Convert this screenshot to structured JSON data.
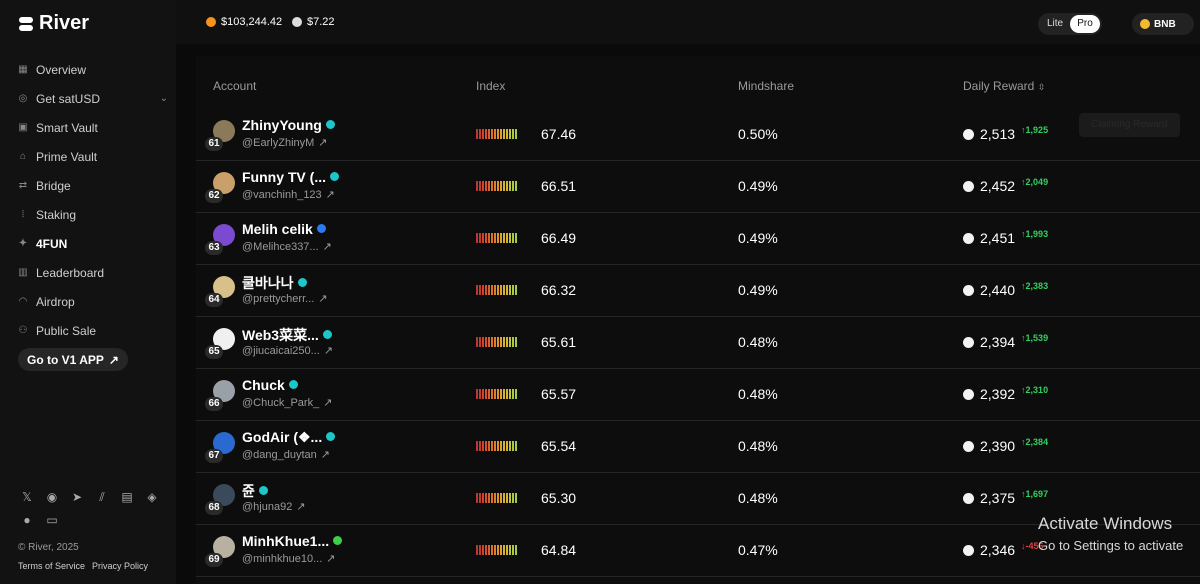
{
  "brand": {
    "name": "River"
  },
  "topbar": {
    "prices": [
      {
        "label": "$103,244.42",
        "icon": "bitcoin-icon",
        "color": "#f7931a"
      },
      {
        "label": "$7.22",
        "icon": "river-token-icon",
        "color": "#ffffff"
      }
    ],
    "mode": {
      "lite": "Lite",
      "pro": "Pro",
      "active": "Pro"
    },
    "chain": {
      "label": "BNB",
      "icon": "bnb-icon",
      "color": "#f3ba2f"
    }
  },
  "sidebar": {
    "items": [
      {
        "label": "Overview",
        "icon": "grid-icon"
      },
      {
        "label": "Get satUSD",
        "icon": "circle-dollar-icon",
        "expandable": true
      },
      {
        "label": "Smart Vault",
        "icon": "vault-icon"
      },
      {
        "label": "Prime Vault",
        "icon": "bank-icon"
      },
      {
        "label": "Bridge",
        "icon": "swap-arrows-icon"
      },
      {
        "label": "Staking",
        "icon": "chart-up-icon"
      },
      {
        "label": "4FUN",
        "icon": "fun-icon",
        "active": true
      },
      {
        "label": "Leaderboard",
        "icon": "bar-chart-icon"
      },
      {
        "label": "Airdrop",
        "icon": "parachute-icon"
      },
      {
        "label": "Public Sale",
        "icon": "users-icon"
      }
    ],
    "v1_button": "Go to V1 APP",
    "socials": [
      "x-icon",
      "discord-icon",
      "telegram-icon",
      "mirror-icon",
      "docs-icon",
      "layers-icon",
      "github-icon",
      "scroll-icon"
    ],
    "copyright": "© River, 2025",
    "terms": "Terms of Service",
    "privacy": "Privacy Policy"
  },
  "table": {
    "headers": {
      "account": "Account",
      "index": "Index",
      "mindshare": "Mindshare",
      "reward": "Daily Reward"
    },
    "ghost_button": "Claiming Reward",
    "rows": [
      {
        "rank": "61",
        "name": "ZhinyYoung",
        "handle": "@EarlyZhinyM",
        "index": "67.46",
        "mindshare": "0.50%",
        "reward": "2,513",
        "delta": "↑1,925",
        "dir": "up",
        "avatar": "#8a7a5a",
        "badge": "#1dc6c9"
      },
      {
        "rank": "62",
        "name": "Funny TV (...",
        "handle": "@vanchinh_123",
        "index": "66.51",
        "mindshare": "0.49%",
        "reward": "2,452",
        "delta": "↑2,049",
        "dir": "up",
        "avatar": "#c9a06a",
        "badge": "#1dc6c9"
      },
      {
        "rank": "63",
        "name": "Melih celik",
        "handle": "@Melihce337...",
        "index": "66.49",
        "mindshare": "0.49%",
        "reward": "2,451",
        "delta": "↑1,993",
        "dir": "up",
        "avatar": "#7a4ad0",
        "badge": "#2a7bf0"
      },
      {
        "rank": "64",
        "name": "쿨바나나",
        "handle": "@prettycherr...",
        "index": "66.32",
        "mindshare": "0.49%",
        "reward": "2,440",
        "delta": "↑2,383",
        "dir": "up",
        "avatar": "#d8c08a",
        "badge": "#1dc6c9"
      },
      {
        "rank": "65",
        "name": "Web3菜菜...",
        "handle": "@jiucaicai250...",
        "index": "65.61",
        "mindshare": "0.48%",
        "reward": "2,394",
        "delta": "↑1,539",
        "dir": "up",
        "avatar": "#f0f0f0",
        "badge": "#1dc6c9"
      },
      {
        "rank": "66",
        "name": "Chuck",
        "handle": "@Chuck_Park_",
        "index": "65.57",
        "mindshare": "0.48%",
        "reward": "2,392",
        "delta": "↑2,310",
        "dir": "up",
        "avatar": "#9aa0a8",
        "badge": "#1dc6c9"
      },
      {
        "rank": "67",
        "name": "GodAir (❖...",
        "handle": "@dang_duytan",
        "index": "65.54",
        "mindshare": "0.48%",
        "reward": "2,390",
        "delta": "↑2,384",
        "dir": "up",
        "avatar": "#2a6ad0",
        "badge": "#1dc6c9"
      },
      {
        "rank": "68",
        "name": "쥰",
        "handle": "@hjuna92",
        "index": "65.30",
        "mindshare": "0.48%",
        "reward": "2,375",
        "delta": "↑1,697",
        "dir": "up",
        "avatar": "#3a4a5a",
        "badge": "#1dc6c9"
      },
      {
        "rank": "69",
        "name": "MinhKhue1...",
        "handle": "@minhkhue10...",
        "index": "64.84",
        "mindshare": "0.47%",
        "reward": "2,346",
        "delta": "↓-456",
        "dir": "down",
        "avatar": "#b8b0a0",
        "badge": "#3ad04a"
      }
    ]
  },
  "watermark": {
    "line1": "Activate Windows",
    "line2": "Go to Settings to activate"
  }
}
